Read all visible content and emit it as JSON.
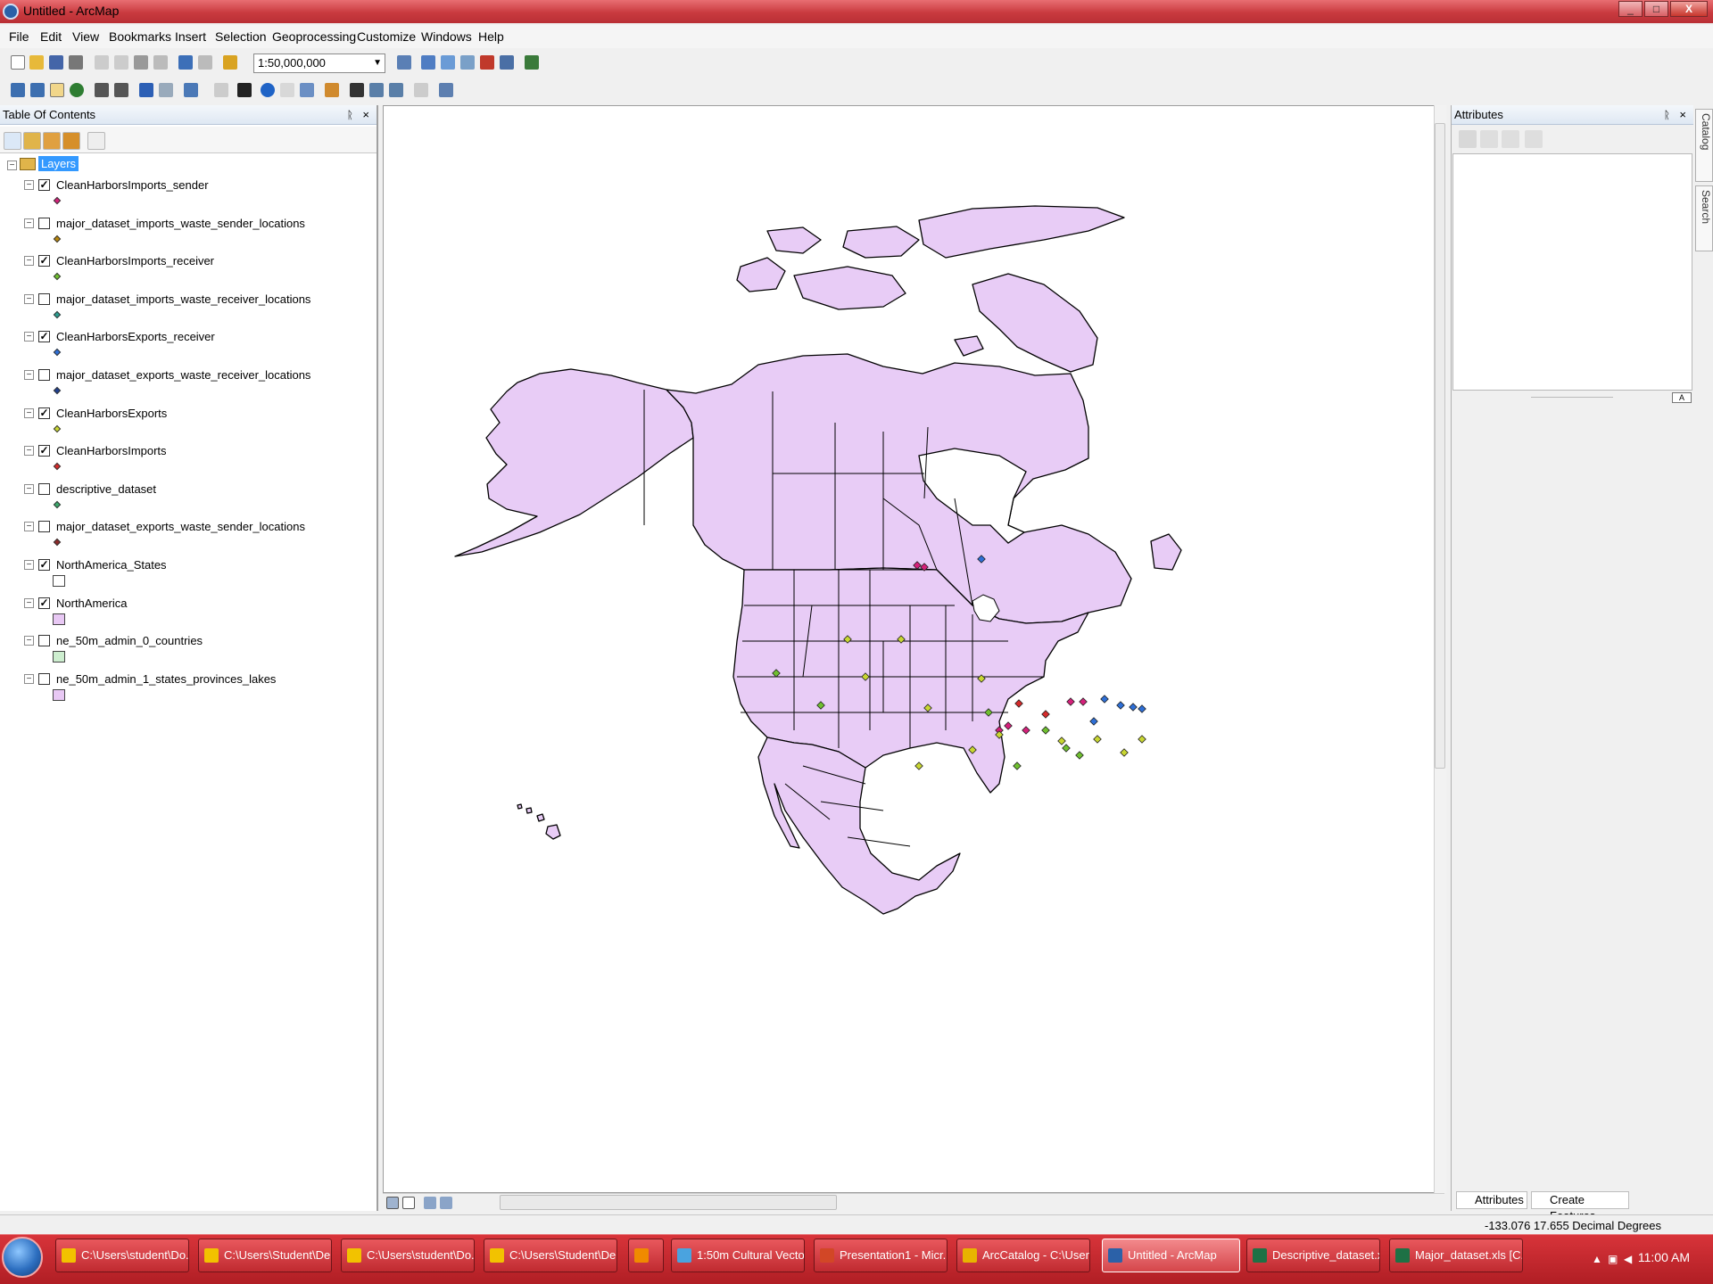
{
  "window": {
    "title": "Untitled - ArcMap",
    "minimize": "_",
    "maximize": "□",
    "close": "X"
  },
  "menu": [
    "File",
    "Edit",
    "View",
    "Bookmarks",
    "Insert",
    "Selection",
    "Geoprocessing",
    "Customize",
    "Windows",
    "Help"
  ],
  "toolbar": {
    "scale_value": "1:50,000,000"
  },
  "toc": {
    "title": "Table Of Contents",
    "pin": "ᚱ",
    "close": "×",
    "root_label": "Layers",
    "layers": [
      {
        "name": "CleanHarborsImports_sender",
        "checked": "✓",
        "symbol_color": "#d4217a",
        "symbol": "point"
      },
      {
        "name": "major_dataset_imports_waste_sender_locations",
        "checked": "",
        "symbol_color": "#b8860b",
        "symbol": "point"
      },
      {
        "name": "CleanHarborsImports_receiver",
        "checked": "✓",
        "symbol_color": "#6fbf2f",
        "symbol": "point"
      },
      {
        "name": "major_dataset_imports_waste_receiver_locations",
        "checked": "",
        "symbol_color": "#2a9d8f",
        "symbol": "point"
      },
      {
        "name": "CleanHarborsExports_receiver",
        "checked": "✓",
        "symbol_color": "#2e6fd6",
        "symbol": "point"
      },
      {
        "name": "major_dataset_exports_waste_receiver_locations",
        "checked": "",
        "symbol_color": "#1f3f8f",
        "symbol": "point"
      },
      {
        "name": "CleanHarborsExports",
        "checked": "✓",
        "symbol_color": "#c8d632",
        "symbol": "point"
      },
      {
        "name": "CleanHarborsImports",
        "checked": "✓",
        "symbol_color": "#d42a2a",
        "symbol": "point"
      },
      {
        "name": "descriptive_dataset",
        "checked": "",
        "symbol_color": "#3aa86b",
        "symbol": "point"
      },
      {
        "name": "major_dataset_exports_waste_sender_locations",
        "checked": "",
        "symbol_color": "#8b2a2a",
        "symbol": "point"
      },
      {
        "name": "NorthAmerica_States",
        "checked": "✓",
        "symbol_color": "#ffffff",
        "symbol": "polygon"
      },
      {
        "name": "NorthAmerica",
        "checked": "✓",
        "symbol_color": "#e8c8f4",
        "symbol": "polygon"
      },
      {
        "name": "ne_50m_admin_0_countries",
        "checked": "",
        "symbol_color": "#cdeecf",
        "symbol": "polygon"
      },
      {
        "name": "ne_50m_admin_1_states_provinces_lakes",
        "checked": "",
        "symbol_color": "#e8c8f4",
        "symbol": "polygon"
      }
    ]
  },
  "map": {
    "land_color": "#e8ccf6",
    "outline_color": "#000000"
  },
  "attributes": {
    "title": "Attributes",
    "pin": "ᚱ",
    "close": "×",
    "side_tabs": [
      "Catalog",
      "Search"
    ],
    "bottom_tabs": [
      "Attributes",
      "Create Features"
    ]
  },
  "status": {
    "coords": "-133.076  17.655 Decimal Degrees"
  },
  "taskbar": {
    "items": [
      {
        "label": "C:\\Users\\student\\Do...",
        "color": "#f2c200"
      },
      {
        "label": "C:\\Users\\Student\\De...",
        "color": "#f2c200"
      },
      {
        "label": "C:\\Users\\student\\Do...",
        "color": "#f2c200"
      },
      {
        "label": "C:\\Users\\Student\\De...",
        "color": "#f2c200"
      },
      {
        "label": "",
        "color": "#f08a00"
      },
      {
        "label": "1:50m Cultural Vecto...",
        "color": "#4aa3df"
      },
      {
        "label": "Presentation1 - Micr...",
        "color": "#d24726"
      },
      {
        "label": "ArcCatalog - C:\\User...",
        "color": "#e8b400"
      },
      {
        "label": "Untitled - ArcMap",
        "color": "#2b61a8"
      },
      {
        "label": "Descriptive_dataset.x...",
        "color": "#1e7145"
      },
      {
        "label": "Major_dataset.xls  [C...",
        "color": "#1e7145"
      }
    ],
    "time": "11:00 AM"
  }
}
